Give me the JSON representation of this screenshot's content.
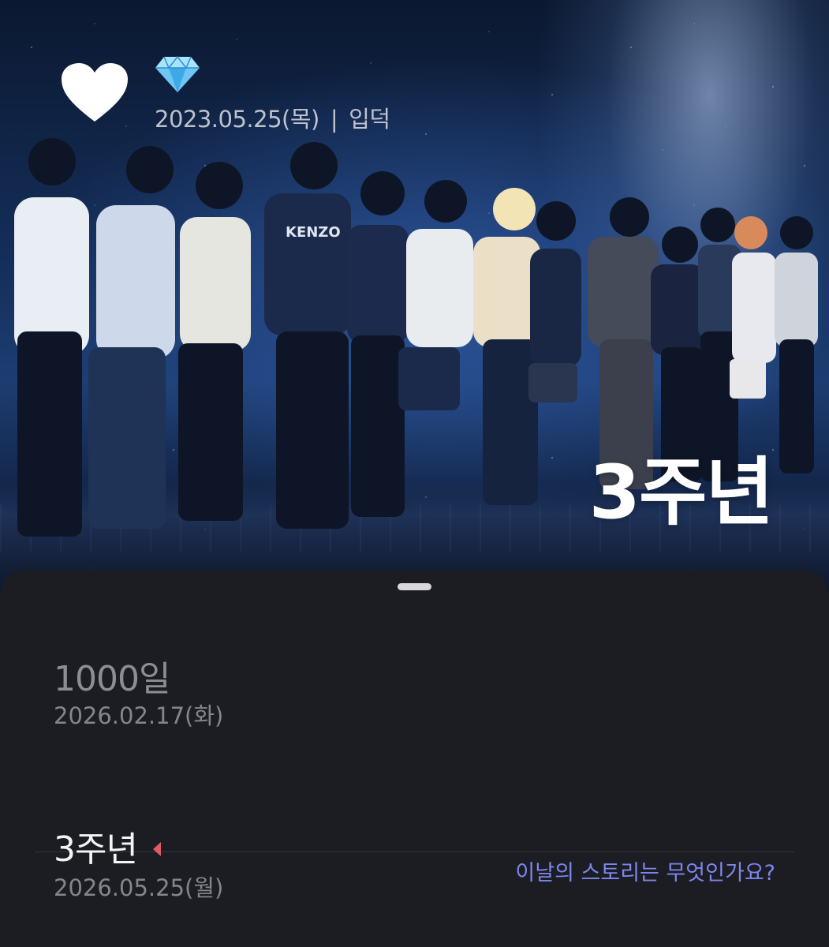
{
  "hero": {
    "gem_icon": "diamond-icon",
    "heart_icon": "heart-icon",
    "start_date": "2023.05.25(목)",
    "separator": "|",
    "start_label": "입덕",
    "big_label": "3주년",
    "photo_text": "KENZO"
  },
  "sheet": {
    "anniversaries": [
      {
        "title": "1000일",
        "date": "2026.02.17(화)"
      },
      {
        "title": "3주년",
        "date": "2026.05.25(월)",
        "story_prompt": "이날의 스토리는 무엇인가요?"
      }
    ]
  },
  "colors": {
    "accent_link": "#7d86ee",
    "marker": "#e05a66",
    "sheet_bg": "#1c1d22"
  }
}
